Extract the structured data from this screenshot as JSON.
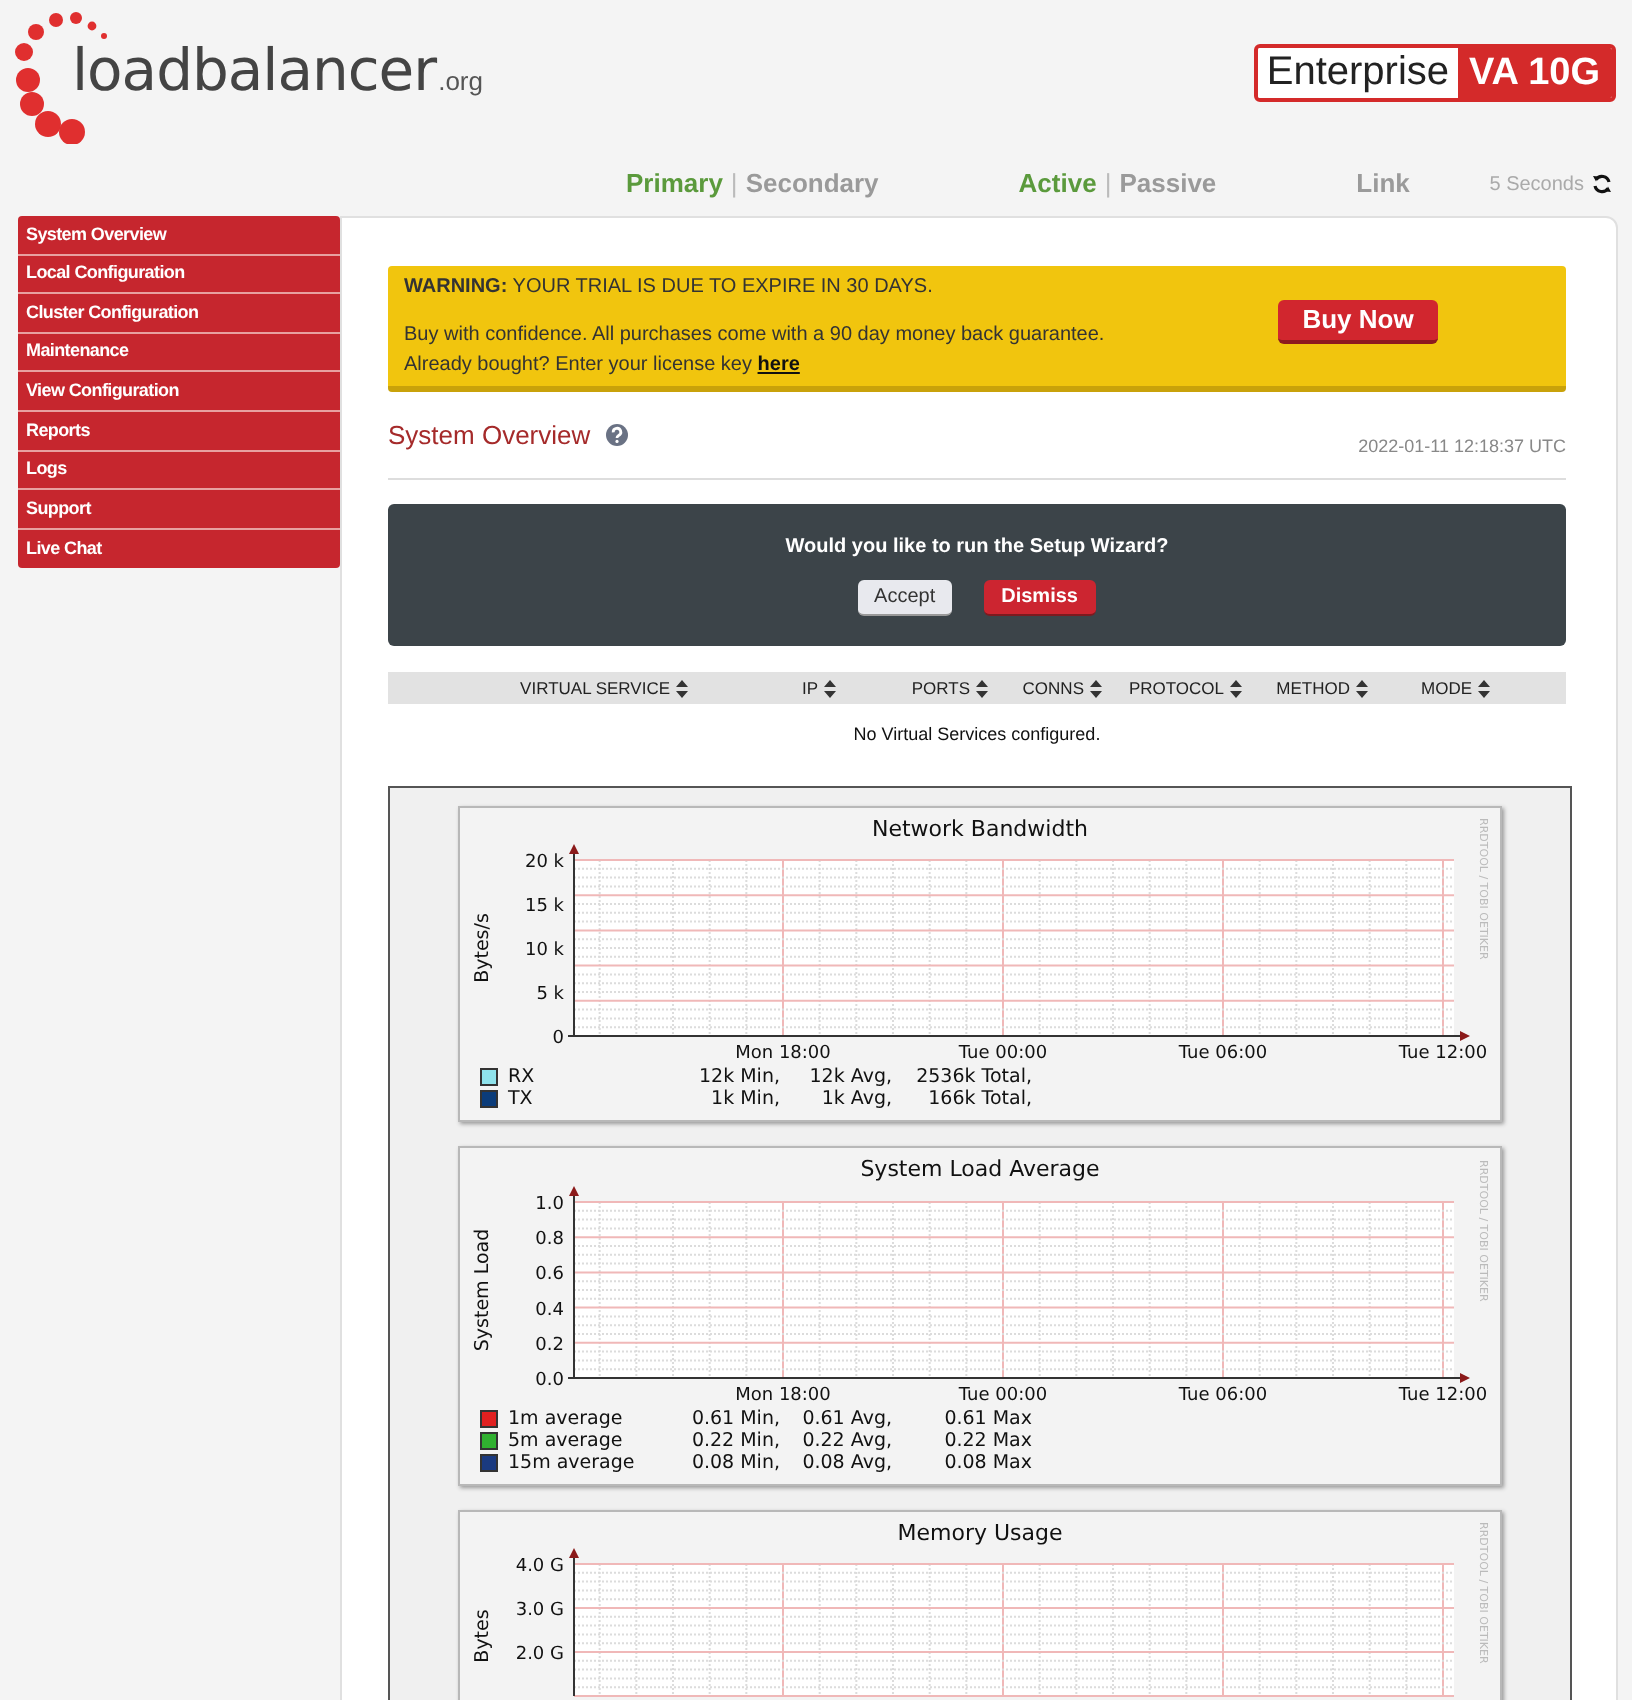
{
  "logo": {
    "name": "loadbalancer",
    "suffix": ".org"
  },
  "edition": {
    "name": "Enterprise",
    "model": "VA 10G"
  },
  "status_groups": [
    {
      "items": [
        {
          "label": "Primary",
          "selected": true
        },
        {
          "label": "Secondary",
          "selected": false
        }
      ]
    },
    {
      "items": [
        {
          "label": "Active",
          "selected": true
        },
        {
          "label": "Passive",
          "selected": false
        }
      ]
    },
    {
      "items": [
        {
          "label": "Link",
          "selected": false
        }
      ]
    }
  ],
  "status_separator": "|",
  "refresh": {
    "label": "5 Seconds"
  },
  "sidebar": {
    "items": [
      {
        "label": "System Overview"
      },
      {
        "label": "Local Configuration"
      },
      {
        "label": "Cluster Configuration"
      },
      {
        "label": "Maintenance"
      },
      {
        "label": "View Configuration"
      },
      {
        "label": "Reports"
      },
      {
        "label": "Logs"
      },
      {
        "label": "Support"
      },
      {
        "label": "Live Chat"
      }
    ]
  },
  "warning": {
    "title": "WARNING:",
    "message": "YOUR TRIAL IS DUE TO EXPIRE IN 30 DAYS.",
    "line_1": "Buy with confidence. All purchases come with a 90 day money back guarantee.",
    "line_2": "Already bought? Enter your license key",
    "link": "here",
    "button": "Buy Now"
  },
  "page_title": "System Overview",
  "timestamp": "2022-01-11 12:18:37 UTC",
  "wizard": {
    "question": "Would you like to run the Setup Wizard?",
    "buttons": [
      {
        "label": "Accept",
        "kind": "secondary"
      },
      {
        "label": "Dismiss",
        "kind": "danger"
      }
    ]
  },
  "table": {
    "columns": [
      "VIRTUAL SERVICE",
      "IP",
      "PORTS",
      "CONNS",
      "PROTOCOL",
      "METHOD",
      "MODE"
    ],
    "empty_message": "No Virtual Services configured."
  },
  "graphs": [
    {
      "chart_data": {
        "type": "line",
        "title": "Network Bandwidth",
        "ylabel": "Bytes/s",
        "ylim": [
          0,
          20000
        ],
        "yticks": [
          {
            "value": 0,
            "label": "0"
          },
          {
            "value": 5000,
            "label": "5 k"
          },
          {
            "value": 10000,
            "label": "10 k"
          },
          {
            "value": 15000,
            "label": "15 k"
          },
          {
            "value": 20000,
            "label": "20 k"
          }
        ],
        "grid": true,
        "categories": [
          null,
          null,
          null,
          null,
          null,
          "Mon 18:00",
          null,
          null,
          null,
          null,
          null,
          "Tue 00:00",
          null,
          null,
          null,
          null,
          null,
          "Tue 06:00",
          null,
          null,
          null,
          null,
          null,
          "Tue 12:00"
        ]
      },
      "legend": [
        {
          "name": "RX",
          "color": "#8fe3ec",
          "stats": [
            "12k Min,",
            "12k Avg,",
            "2536k Total,"
          ]
        },
        {
          "name": "TX",
          "color": "#0b3c7a",
          "stats": [
            "1k Min,",
            "1k Avg,",
            "166k Total,"
          ]
        }
      ],
      "credit": "RRDTOOL / TOBI OETIKER"
    },
    {
      "chart_data": {
        "type": "line",
        "title": "System Load Average",
        "ylabel": "System Load",
        "ylim": [
          0,
          1
        ],
        "yticks": [
          {
            "value": 0,
            "label": "0.0"
          },
          {
            "value": 0.2,
            "label": "0.2"
          },
          {
            "value": 0.4,
            "label": "0.4"
          },
          {
            "value": 0.6,
            "label": "0.6"
          },
          {
            "value": 0.8,
            "label": "0.8"
          },
          {
            "value": 1,
            "label": "1.0"
          }
        ],
        "grid": true,
        "categories": [
          null,
          null,
          null,
          null,
          null,
          "Mon 18:00",
          null,
          null,
          null,
          null,
          null,
          "Tue 00:00",
          null,
          null,
          null,
          null,
          null,
          "Tue 06:00",
          null,
          null,
          null,
          null,
          null,
          "Tue 12:00"
        ]
      },
      "legend": [
        {
          "name": "1m average",
          "color": "#e02020",
          "stats": [
            "0.61 Min,",
            "0.61 Avg,",
            "0.61 Max"
          ]
        },
        {
          "name": "5m average",
          "color": "#30b030",
          "stats": [
            "0.22 Min,",
            "0.22 Avg,",
            "0.22 Max"
          ]
        },
        {
          "name": "15m average",
          "color": "#1a3a80",
          "stats": [
            "0.08 Min,",
            "0.08 Avg,",
            "0.08 Max"
          ]
        }
      ],
      "credit": "RRDTOOL / TOBI OETIKER"
    },
    {
      "chart_data": {
        "type": "line",
        "title": "Memory Usage",
        "ylabel": "Bytes",
        "ylim": [
          1,
          4
        ],
        "yticks": [
          {
            "value": 2,
            "label": "2.0 G"
          },
          {
            "value": 3,
            "label": "3.0 G"
          },
          {
            "value": 4,
            "label": "4.0 G"
          }
        ],
        "grid": true,
        "categories": [
          null,
          null,
          null,
          null,
          null,
          null,
          null,
          null,
          null,
          null,
          null,
          null,
          null,
          null,
          null,
          null,
          null,
          null,
          null,
          null,
          null,
          null,
          null,
          null
        ]
      },
      "credit": "RRDTOOL / TOBI OETIKER"
    }
  ]
}
